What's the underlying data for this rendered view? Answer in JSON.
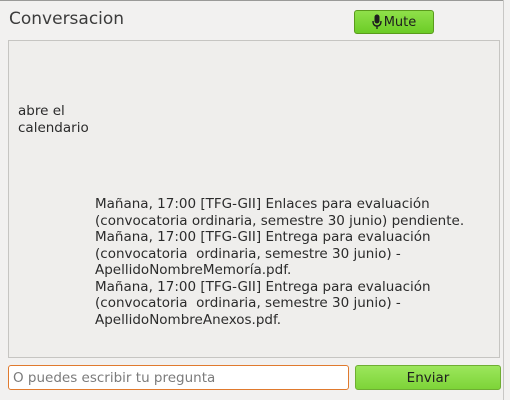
{
  "header": {
    "title": "Conversacion",
    "mute_label": "Mute",
    "mute_icon": "microphone-icon"
  },
  "conversation": {
    "user_message": "abre el\ncalendario",
    "bot_lines": [
      "Mañana, 17:00 [TFG-GII] Enlaces para evaluación",
      "(convocatoria ordinaria, semestre 30 junio) pendiente.",
      "Mañana, 17:00 [TFG-GII] Entrega para evaluación",
      "(convocatoria  ordinaria, semestre 30 junio) -",
      "ApellidoNombreMemoría.pdf.",
      "Mañana, 17:00 [TFG-GII] Entrega para evaluación",
      "(convocatoria  ordinaria, semestre 30 junio) -",
      "ApellidoNombreAnexos.pdf."
    ]
  },
  "input": {
    "placeholder": "O puedes escribir tu pregunta",
    "value": "",
    "send_label": "Enviar"
  },
  "colors": {
    "button_green": "#7dd438",
    "input_focus_border": "#e07a2e",
    "background": "#f2f1f0"
  }
}
